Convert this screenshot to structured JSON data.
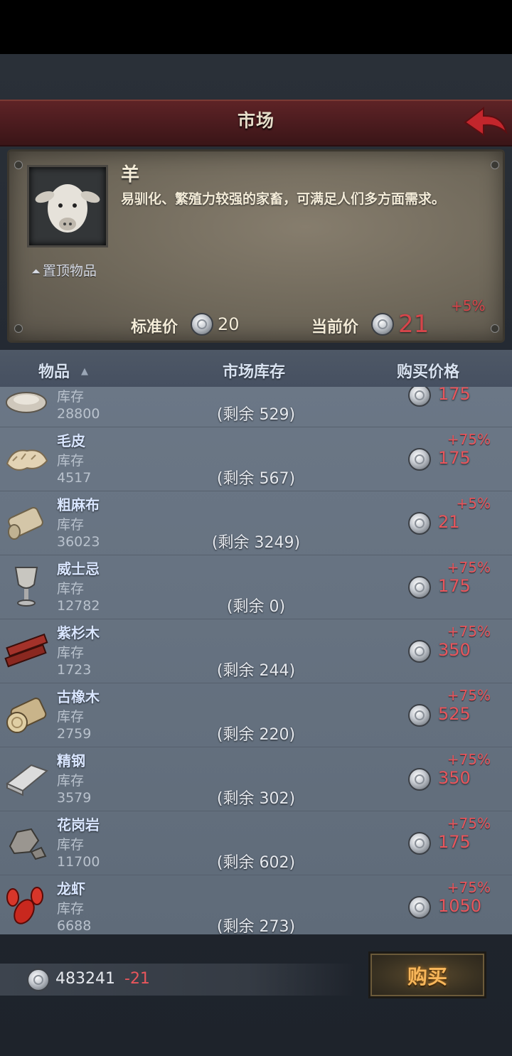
{
  "title": "市场",
  "selected_item": {
    "name": "羊",
    "description": "易驯化、繁殖力较强的家畜，可满足人们多方面需求。",
    "pin_label": "置顶物品",
    "standard_price_label": "标准价",
    "standard_price": "20",
    "current_price_label": "当前价",
    "current_price": "21",
    "price_change": "+5%"
  },
  "list_headers": {
    "item": "物品",
    "stock": "市场库存",
    "price": "购买价格"
  },
  "rows": [
    {
      "name": "",
      "stock_label": "库存",
      "stock": "28800",
      "remaining": "(剩余 529)",
      "pct": "",
      "price": "175",
      "icon": "oyster-icon"
    },
    {
      "name": "毛皮",
      "stock_label": "库存",
      "stock": "4517",
      "remaining": "(剩余 567)",
      "pct": "+75%",
      "price": "175",
      "icon": "fur-icon"
    },
    {
      "name": "粗麻布",
      "stock_label": "库存",
      "stock": "36023",
      "remaining": "(剩余 3249)",
      "pct": "+5%",
      "price": "21",
      "icon": "linen-roll-icon"
    },
    {
      "name": "威士忌",
      "stock_label": "库存",
      "stock": "12782",
      "remaining": "(剩余 0)",
      "pct": "+75%",
      "price": "175",
      "icon": "goblet-icon"
    },
    {
      "name": "紫杉木",
      "stock_label": "库存",
      "stock": "1723",
      "remaining": "(剩余 244)",
      "pct": "+75%",
      "price": "350",
      "icon": "yew-planks-icon"
    },
    {
      "name": "古橡木",
      "stock_label": "库存",
      "stock": "2759",
      "remaining": "(剩余 220)",
      "pct": "+75%",
      "price": "525",
      "icon": "oak-log-icon"
    },
    {
      "name": "精钢",
      "stock_label": "库存",
      "stock": "3579",
      "remaining": "(剩余 302)",
      "pct": "+75%",
      "price": "350",
      "icon": "steel-ingot-icon"
    },
    {
      "name": "花岗岩",
      "stock_label": "库存",
      "stock": "11700",
      "remaining": "(剩余 602)",
      "pct": "+75%",
      "price": "175",
      "icon": "granite-icon"
    },
    {
      "name": "龙虾",
      "stock_label": "库存",
      "stock": "6688",
      "remaining": "(剩余 273)",
      "pct": "+75%",
      "price": "1050",
      "icon": "lobster-icon"
    }
  ],
  "footer": {
    "money": "483241",
    "delta": "-21",
    "buy_label": "购买"
  },
  "colors": {
    "title_bar": "#4a1b1e",
    "price_increase": "#e8565c",
    "buy_text": "#f7b65a"
  }
}
